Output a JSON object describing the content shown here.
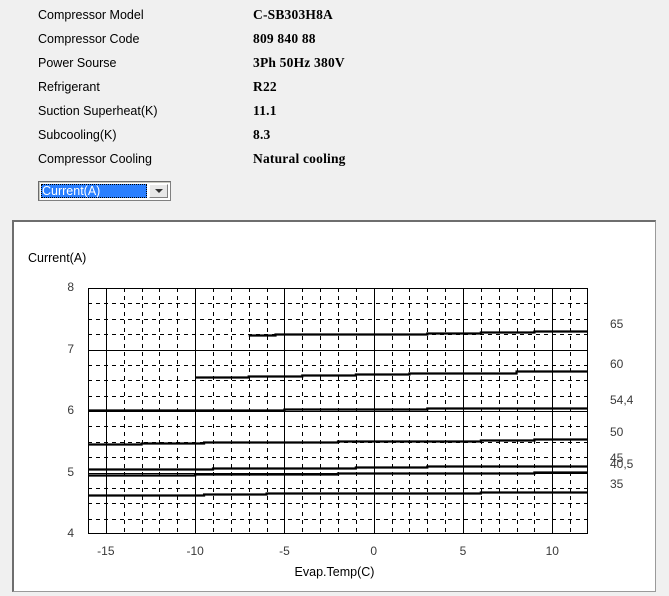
{
  "info": {
    "rows": [
      {
        "label": "Compressor  Model",
        "value": "C-SB303H8A"
      },
      {
        "label": "Compressor Code",
        "value": "809 840 88"
      },
      {
        "label": "Power Sourse",
        "value": "3Ph  50Hz  380V"
      },
      {
        "label": "Refrigerant",
        "value": "R22"
      },
      {
        "label": "Suction Superheat(K)",
        "value": "11.1"
      },
      {
        "label": "Subcooling(K)",
        "value": "8.3"
      },
      {
        "label": "Compressor Cooling",
        "value": "Natural cooling"
      }
    ]
  },
  "parameter_select": {
    "selected": "Current(A)",
    "options": [
      "Current(A)"
    ],
    "arrow_icon": "chevron-down-icon",
    "highlight_color": "#2a7fff"
  },
  "chart_data": {
    "type": "line",
    "title": "",
    "xlabel": "Evap.Temp(C)",
    "ylabel": "Current(A)",
    "xlim": [
      -16,
      12
    ],
    "ylim": [
      4,
      8
    ],
    "xticks": [
      -15,
      -10,
      -5,
      0,
      5,
      10
    ],
    "yticks": [
      4,
      5,
      6,
      7,
      8
    ],
    "grid": true,
    "minor_grid": true,
    "legend_position": "right-axis-labels",
    "right_axis_labels": [
      "65",
      "60",
      "54,4",
      "50",
      "45",
      "40,5",
      "35"
    ],
    "series": [
      {
        "name": "65",
        "label": "65",
        "x": [
          -7.0,
          -5.5,
          -3.0,
          0.0,
          3.0,
          6.0,
          9.0,
          12.0
        ],
        "y": [
          7.24,
          7.26,
          7.26,
          7.26,
          7.27,
          7.28,
          7.3,
          7.31
        ]
      },
      {
        "name": "60",
        "label": "60",
        "x": [
          -10.0,
          -7.0,
          -4.0,
          -1.0,
          2.0,
          5.0,
          8.0,
          12.0
        ],
        "y": [
          6.56,
          6.57,
          6.58,
          6.6,
          6.61,
          6.62,
          6.65,
          6.66
        ]
      },
      {
        "name": "54,4",
        "label": "54,4",
        "x": [
          -16.0,
          -12.5,
          -9.0,
          -5.0,
          -1.0,
          3.0,
          7.0,
          12.0
        ],
        "y": [
          6.01,
          6.01,
          6.02,
          6.03,
          6.04,
          6.05,
          6.05,
          6.06
        ]
      },
      {
        "name": "50",
        "label": "50",
        "x": [
          -16.0,
          -13.0,
          -9.5,
          -6.0,
          -2.0,
          2.0,
          6.0,
          9.0,
          12.0
        ],
        "y": [
          5.47,
          5.48,
          5.49,
          5.5,
          5.51,
          5.52,
          5.53,
          5.54,
          5.55
        ]
      },
      {
        "name": "45",
        "label": "45",
        "x": [
          -16.0,
          -12.5,
          -9.0,
          -5.0,
          -1.0,
          3.0,
          7.0,
          12.0
        ],
        "y": [
          5.06,
          5.06,
          5.07,
          5.08,
          5.09,
          5.1,
          5.11,
          5.12
        ]
      },
      {
        "name": "40,5",
        "label": "40,5",
        "x": [
          -16.0,
          -13.0,
          -10.0,
          -6.0,
          -2.0,
          2.0,
          6.0,
          9.0,
          12.0
        ],
        "y": [
          4.96,
          4.96,
          4.97,
          4.98,
          4.99,
          5.0,
          5.0,
          5.01,
          5.02
        ]
      },
      {
        "name": "35",
        "label": "35",
        "x": [
          -16.0,
          -13.0,
          -9.5,
          -6.0,
          -2.0,
          2.0,
          6.0,
          9.0,
          12.0
        ],
        "y": [
          4.64,
          4.64,
          4.65,
          4.66,
          4.66,
          4.67,
          4.68,
          4.68,
          4.69
        ]
      }
    ]
  }
}
